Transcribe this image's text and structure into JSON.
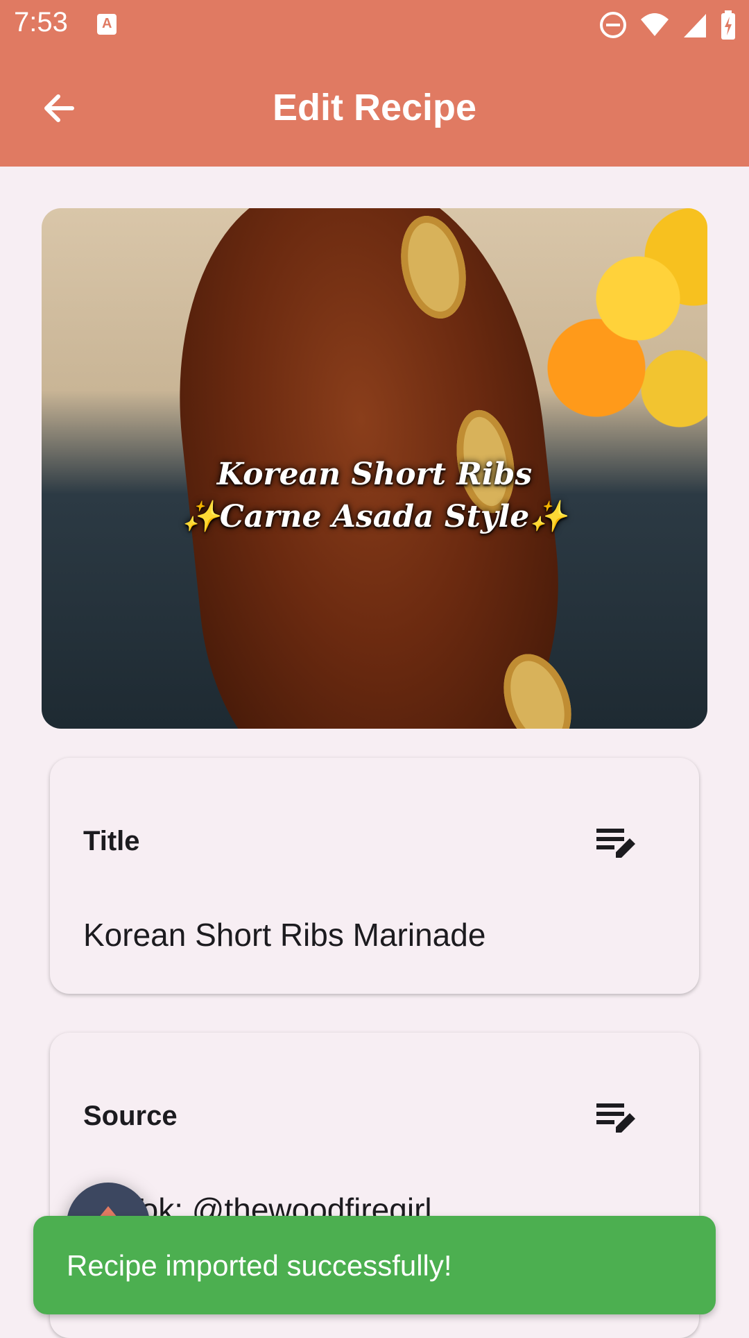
{
  "status_bar": {
    "time": "7:53",
    "notification_icon": "app-notification-icon",
    "icons": [
      "do-not-disturb-icon",
      "wifi-icon",
      "signal-icon",
      "battery-charging-icon"
    ]
  },
  "app_bar": {
    "title": "Edit Recipe",
    "back_icon": "arrow-back-icon",
    "color": "#e07a62"
  },
  "hero_image": {
    "caption_line1": "Korean Short Ribs",
    "caption_line2": "✨Carne Asada Style✨"
  },
  "fields": [
    {
      "label": "Title",
      "value": "Korean Short Ribs Marinade",
      "edit_icon": "edit-note-icon"
    },
    {
      "label": "Source",
      "value": "TikTok: @thewoodfiregirl",
      "edit_icon": "edit-note-icon"
    }
  ],
  "fab": {
    "icon": "scroll-up-icon",
    "color": "#3c4760"
  },
  "snackbar": {
    "message": "Recipe imported successfully!",
    "color": "#4caf50"
  }
}
